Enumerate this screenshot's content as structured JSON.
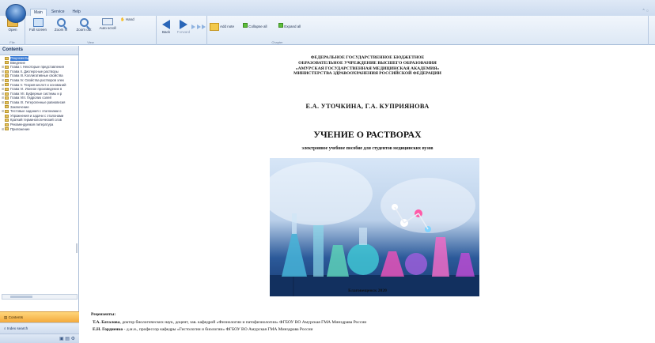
{
  "tabs": [
    "Main",
    "Service",
    "Help"
  ],
  "ribbon": {
    "groups": [
      {
        "label": "File",
        "buttons": [
          "Open"
        ]
      },
      {
        "label": "View",
        "buttons": [
          "Full screen",
          "Zoom in",
          "Zoom out",
          "Auto scroll",
          "Hand"
        ]
      },
      {
        "label": "",
        "buttons": [
          "Back",
          "Forward"
        ]
      },
      {
        "label": "Chapter",
        "buttons": [
          "Add note",
          "Collapse all",
          "Expand all"
        ]
      }
    ]
  },
  "contents": {
    "title": "Contents",
    "items": [
      {
        "label": "Рецензенты",
        "selected": true,
        "expand": false
      },
      {
        "label": "Введение",
        "selected": false,
        "expand": false
      },
      {
        "label": "Глава I. Некоторые представления",
        "selected": false,
        "expand": true
      },
      {
        "label": "Глава II. Дисперсные растворы",
        "selected": false,
        "expand": true
      },
      {
        "label": "Глава III. Коллигативные свойства",
        "selected": false,
        "expand": true
      },
      {
        "label": "Глава IV. Свойства растворов элек",
        "selected": false,
        "expand": true
      },
      {
        "label": "Глава V. Теория кислот и оснований",
        "selected": false,
        "expand": true
      },
      {
        "label": "Глава VI. Ионное произведение в",
        "selected": false,
        "expand": true
      },
      {
        "label": "Глава VII. Буферные системы и р",
        "selected": false,
        "expand": true
      },
      {
        "label": "Глава VIII. Гидролиз солей",
        "selected": false,
        "expand": true
      },
      {
        "label": "Глава IX. Гетерогенные равновесия",
        "selected": false,
        "expand": true
      },
      {
        "label": "Заключение",
        "selected": false,
        "expand": false
      },
      {
        "label": "Тестовые задания с эталонами о",
        "selected": false,
        "expand": true
      },
      {
        "label": "Упражнения и задачи с эталонами",
        "selected": false,
        "expand": false
      },
      {
        "label": "Краткий терминологический слов",
        "selected": false,
        "expand": false
      },
      {
        "label": "Рекомендуемая литература",
        "selected": false,
        "expand": false
      },
      {
        "label": "Приложение",
        "selected": false,
        "expand": true
      }
    ]
  },
  "nav": {
    "contents": "Contents",
    "search": "Index search"
  },
  "document": {
    "header": [
      "ФЕДЕРАЛЬНОЕ ГОСУДАРСТВЕННОЕ БЮДЖЕТНОЕ",
      "ОБРАЗОВАТЕЛЬНОЕ УЧРЕЖДЕНИЕ ВЫСШЕГО ОБРАЗОВАНИЯ",
      "«АМУРСКАЯ ГОСУДАРСТВЕННАЯ МЕДИЦИНСКАЯ АКАДЕМИЯ»",
      "МИНИСТЕРСТВА ЗДРАВООХРАНЕНИЯ РОССИЙСКОЙ ФЕДЕРАЦИИ"
    ],
    "authors": "Е.А. УТОЧКИНА, Г.А. КУПРИЯНОВА",
    "title": "УЧЕНИЕ О РАСТВОРАХ",
    "subtitle": "электронное учебное пособие для студентов медицинских вузов",
    "city_year": "Благовещенск 2020",
    "reviewers_heading": "Рецензенты:",
    "reviewers": [
      {
        "name": "Т.А. Баталова",
        "text": ", доктор биологических наук, доцент, зав. кафедрой «Физиологии и патофизиологии» ФГБОУ ВО Амурская ГМА Минздрава России"
      },
      {
        "name": "Е.Н. Гордиенко",
        "text": " - д.м.н., профессор кафедры «Гистологии и биологии» ФГБОУ ВО Амурская ГМА Минздрава России"
      }
    ]
  }
}
